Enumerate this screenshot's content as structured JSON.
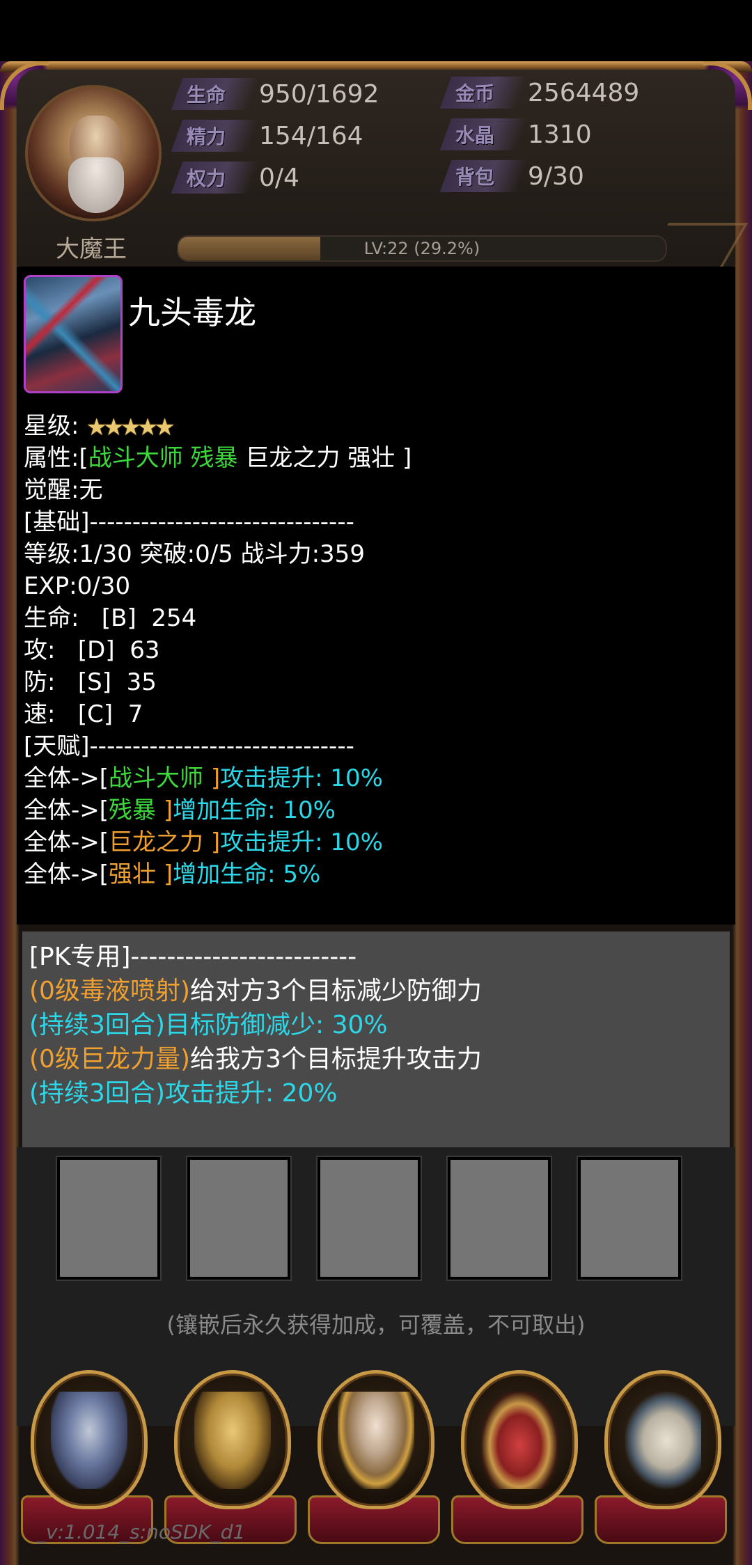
{
  "header": {
    "player_name": "大魔王",
    "stats": [
      {
        "key": "hp",
        "label": "生命",
        "value": "950/1692"
      },
      {
        "key": "energy",
        "label": "精力",
        "value": "154/164"
      },
      {
        "key": "power",
        "label": "权力",
        "value": "0/4"
      },
      {
        "key": "gold",
        "label": "金币",
        "value": "2564489"
      },
      {
        "key": "crystal",
        "label": "水晶",
        "value": "1310"
      },
      {
        "key": "bag",
        "label": "背包",
        "value": "9/30"
      }
    ],
    "level_text": "LV:22 (29.2%)",
    "level_progress": 0.292
  },
  "card": {
    "name": "九头毒龙",
    "star_label": "星级:",
    "stars": 5,
    "attr_prefix": "属性:[",
    "attr_green": "战斗大师 残暴",
    "attr_white": " 巨龙之力 强壮 ]",
    "awaken": "觉醒:无",
    "basic_header": "[基础]-------------------------------",
    "level_line": "等级:1/30  突破:0/5 战斗力:359",
    "exp_line": "EXP:0/30",
    "hp_line": "生命:   [B]  254",
    "atk_line": "攻:   [D]  63",
    "def_line": "防:   [S]  35",
    "spd_line": "速:   [C]  7",
    "talent_header": "[天赋]-------------------------------",
    "talents": [
      {
        "prefix": "全体->[",
        "name": "战斗大师 ",
        "name_color": "green",
        "suffix": "]",
        "effect": "攻击提升: 10%"
      },
      {
        "prefix": "全体->[",
        "name": "残暴 ",
        "name_color": "green",
        "suffix": "]",
        "effect": "增加生命: 10%"
      },
      {
        "prefix": "全体->[",
        "name": "巨龙之力 ",
        "name_color": "orange",
        "suffix": "]",
        "effect": "攻击提升: 10%"
      },
      {
        "prefix": "全体->[",
        "name": "强壮 ",
        "name_color": "orange",
        "suffix": "]",
        "effect": "增加生命: 5%"
      }
    ]
  },
  "pk": {
    "header": "[PK专用]-------------------------",
    "skills": [
      {
        "skill": "(0级毒液喷射)",
        "desc": "给对方3个目标减少防御力",
        "duration": "(持续3回合)",
        "effect": "目标防御减少: 30%"
      },
      {
        "skill": "(0级巨龙力量)",
        "desc": "给我方3个目标提升攻击力",
        "duration": "(持续3回合)",
        "effect": "攻击提升: 20%"
      }
    ]
  },
  "inlay": {
    "slot_count": 5,
    "note": "(镶嵌后永久获得加成，可覆盖，不可取出)"
  },
  "nav": {
    "icons": [
      "armor-icon",
      "helmet-icon",
      "sage-icon",
      "treasure-chest-icon",
      "book-icon"
    ]
  },
  "version": "_v:1.014_s:noSDK_d1",
  "colors": {
    "green": "#3cd83c",
    "orange": "#f0a030",
    "cyan": "#2cd8e8",
    "pk_bg": "#4a4a4a",
    "slot_bg": "#757575"
  }
}
